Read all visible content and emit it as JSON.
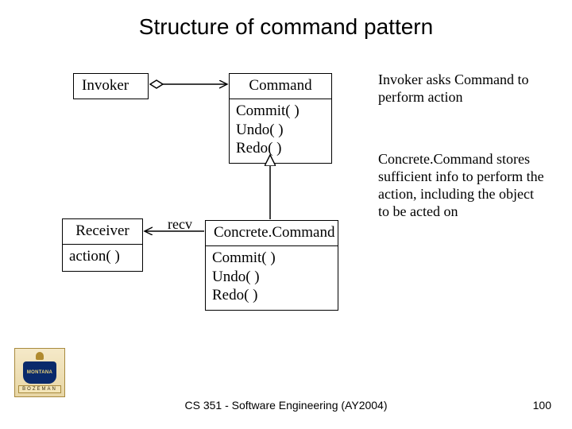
{
  "title": "Structure of command pattern",
  "footer": "CS 351 - Software Engineering (AY2004)",
  "page_number": "100",
  "logo": {
    "text_top": "MONTANA",
    "text_band": "BOZEMAN"
  },
  "classes": {
    "invoker": {
      "name": "Invoker"
    },
    "command": {
      "name": "Command",
      "ops": [
        "Commit( )",
        "Undo( )",
        "Redo( )"
      ]
    },
    "receiver": {
      "name": "Receiver",
      "ops": [
        "action( )"
      ]
    },
    "concrete": {
      "name": "Concrete.Command",
      "ops": [
        "Commit( )",
        "Undo( )",
        "Redo( )"
      ]
    }
  },
  "assoc": {
    "recv_label": "recv"
  },
  "notes": {
    "n1": "Invoker asks Command to perform action",
    "n2": "Concrete.Command stores sufficient info to perform the action, including the object to be acted on"
  }
}
